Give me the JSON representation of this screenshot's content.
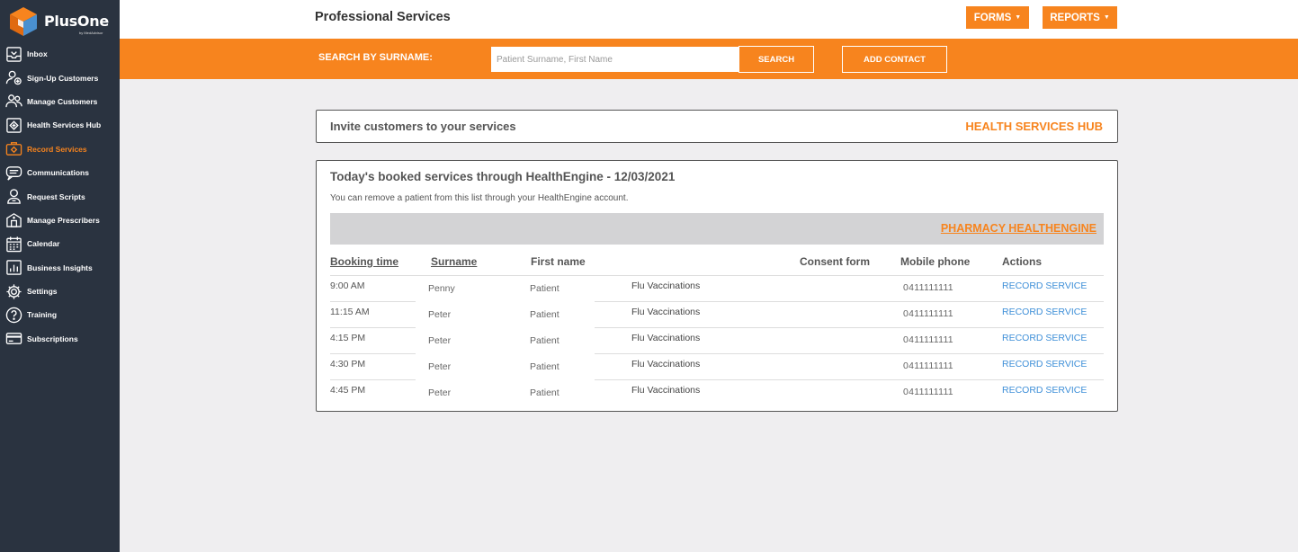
{
  "brand": {
    "name": "PlusOne",
    "sub": "by MedAdvisor"
  },
  "sidebar": {
    "items": [
      {
        "label": "Inbox",
        "icon": "inbox-icon"
      },
      {
        "label": "Sign-Up Customers",
        "icon": "sign-up-icon"
      },
      {
        "label": "Manage Customers",
        "icon": "users-icon"
      },
      {
        "label": "Health Services Hub",
        "icon": "health-hub-icon"
      },
      {
        "label": "Record Services",
        "icon": "record-services-icon",
        "active": true
      },
      {
        "label": "Communications",
        "icon": "communications-icon"
      },
      {
        "label": "Request Scripts",
        "icon": "request-scripts-icon"
      },
      {
        "label": "Manage Prescribers",
        "icon": "prescribers-icon"
      },
      {
        "label": "Calendar",
        "icon": "calendar-icon"
      },
      {
        "label": "Business Insights",
        "icon": "insights-icon"
      },
      {
        "label": "Settings",
        "icon": "gear-icon"
      },
      {
        "label": "Training",
        "icon": "help-icon"
      },
      {
        "label": "Subscriptions",
        "icon": "card-icon"
      }
    ]
  },
  "header": {
    "title": "Professional Services",
    "forms_label": "FORMS",
    "reports_label": "REPORTS"
  },
  "search": {
    "label": "SEARCH BY SURNAME:",
    "placeholder": "Patient Surname, First Name",
    "value": "",
    "search_label": "SEARCH",
    "add_contact_label": "ADD CONTACT"
  },
  "invite": {
    "text": "Invite customers to your services",
    "link": "HEALTH SERVICES HUB"
  },
  "booked": {
    "title": "Today's booked services through HealthEngine - 12/03/2021",
    "subtitle": "You can remove a patient from this list through your HealthEngine account.",
    "pharmacy_link": "PHARMACY HEALTHENGINE",
    "columns": {
      "booking": "Booking time",
      "surname": "Surname",
      "first": "First name",
      "consent": "Consent form",
      "mobile": "Mobile phone",
      "actions": "Actions"
    },
    "rows": [
      {
        "time": "9:00 AM",
        "surname": "Penny",
        "first": "Patient",
        "service": "Flu Vaccinations",
        "mobile": "0411111111",
        "action": "RECORD SERVICE"
      },
      {
        "time": "11:15 AM",
        "surname": "Peter",
        "first": "Patient",
        "service": "Flu Vaccinations",
        "mobile": "0411111111",
        "action": "RECORD SERVICE"
      },
      {
        "time": "4:15 PM",
        "surname": "Peter",
        "first": "Patient",
        "service": "Flu Vaccinations",
        "mobile": "0411111111",
        "action": "RECORD SERVICE"
      },
      {
        "time": "4:30 PM",
        "surname": "Peter",
        "first": "Patient",
        "service": "Flu Vaccinations",
        "mobile": "0411111111",
        "action": "RECORD SERVICE"
      },
      {
        "time": "4:45 PM",
        "surname": "Peter",
        "first": "Patient",
        "service": "Flu Vaccinations",
        "mobile": "0411111111",
        "action": "RECORD SERVICE"
      }
    ]
  },
  "colors": {
    "accent": "#f7841e",
    "sidebar": "#2a3340",
    "link": "#3e8fd8"
  }
}
